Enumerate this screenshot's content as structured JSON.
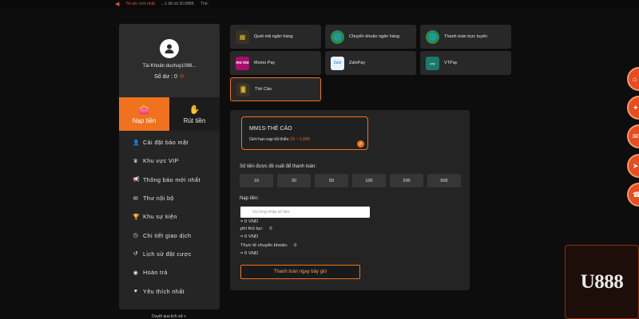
{
  "ticker": {
    "title": "Tin tức mới nhất",
    "item1": "...1 đã rút 35.888K",
    "item2": "Thẻ: "
  },
  "sidebar": {
    "account": "Tài Khoản duchuy1098...",
    "balance_label": "Số dư : 0",
    "tabs": {
      "deposit": "Nạp tiền",
      "withdraw": "Rút tiền"
    },
    "menu": [
      {
        "label": "Cài đặt bảo mật",
        "icon": "user-gear-icon"
      },
      {
        "label": "Khu vực VIP",
        "icon": "crown-icon"
      },
      {
        "label": "Thông báo mới nhất",
        "icon": "megaphone-icon"
      },
      {
        "label": "Thư nội bộ",
        "icon": "envelope-icon"
      },
      {
        "label": "Khu sự kiện",
        "icon": "trophy-icon"
      },
      {
        "label": "Chi tiết giao dịch",
        "icon": "clock-icon"
      },
      {
        "label": "Lịch sử đặt cược",
        "icon": "history-icon"
      },
      {
        "label": "Hoàn trả",
        "icon": "coins-icon"
      },
      {
        "label": "Yêu thích nhất",
        "icon": "heart-icon"
      }
    ],
    "bottom_link": "Duyệt qua lịch sử +"
  },
  "methods": [
    {
      "label": "Quét mã ngân hàng",
      "icon": "qr-icon"
    },
    {
      "label": "Chuyển khoản ngân hàng",
      "icon": "globe-icon"
    },
    {
      "label": "Thanh toán trực tuyến",
      "icon": "globe-icon"
    },
    {
      "label": "Momo Pay",
      "icon": "momo-icon",
      "badge": "mo mo"
    },
    {
      "label": "ZaloPay",
      "icon": "zalo-icon",
      "badge": "Zalo"
    },
    {
      "label": "VTPay",
      "icon": "vtpay-icon",
      "badge": "pay"
    },
    {
      "label": "Thẻ Cào",
      "icon": "card-icon",
      "selected": true
    }
  ],
  "panel": {
    "card_title": "MM1S-THẺ CÀO",
    "limit_prefix": "Giới hạn nạp tối thiểu",
    "limit_range": "10 ~ 1,000",
    "suggest_label": "Số tiền được đề xuất để thanh toán:",
    "amounts": [
      "10",
      "20",
      "50",
      "100",
      "200",
      "500"
    ],
    "deposit_label": "Nạp tiền:",
    "input_placeholder": "Vui lòng nhập số tiền",
    "vnd1": "= 0 VND",
    "fee_label": "phí thủ tục:",
    "fee_value": "0",
    "vnd2": "= 0 VND",
    "actual_label": "Thực tế chuyển khoản:",
    "actual_value": "0",
    "vnd3": "= 0 VND",
    "pay_button": "Thanh toán ngay bây giờ"
  },
  "logo": {
    "text": "U888"
  },
  "colors": {
    "accent": "#f0711e",
    "bg": "#0d0d0d",
    "panel": "#242424"
  }
}
